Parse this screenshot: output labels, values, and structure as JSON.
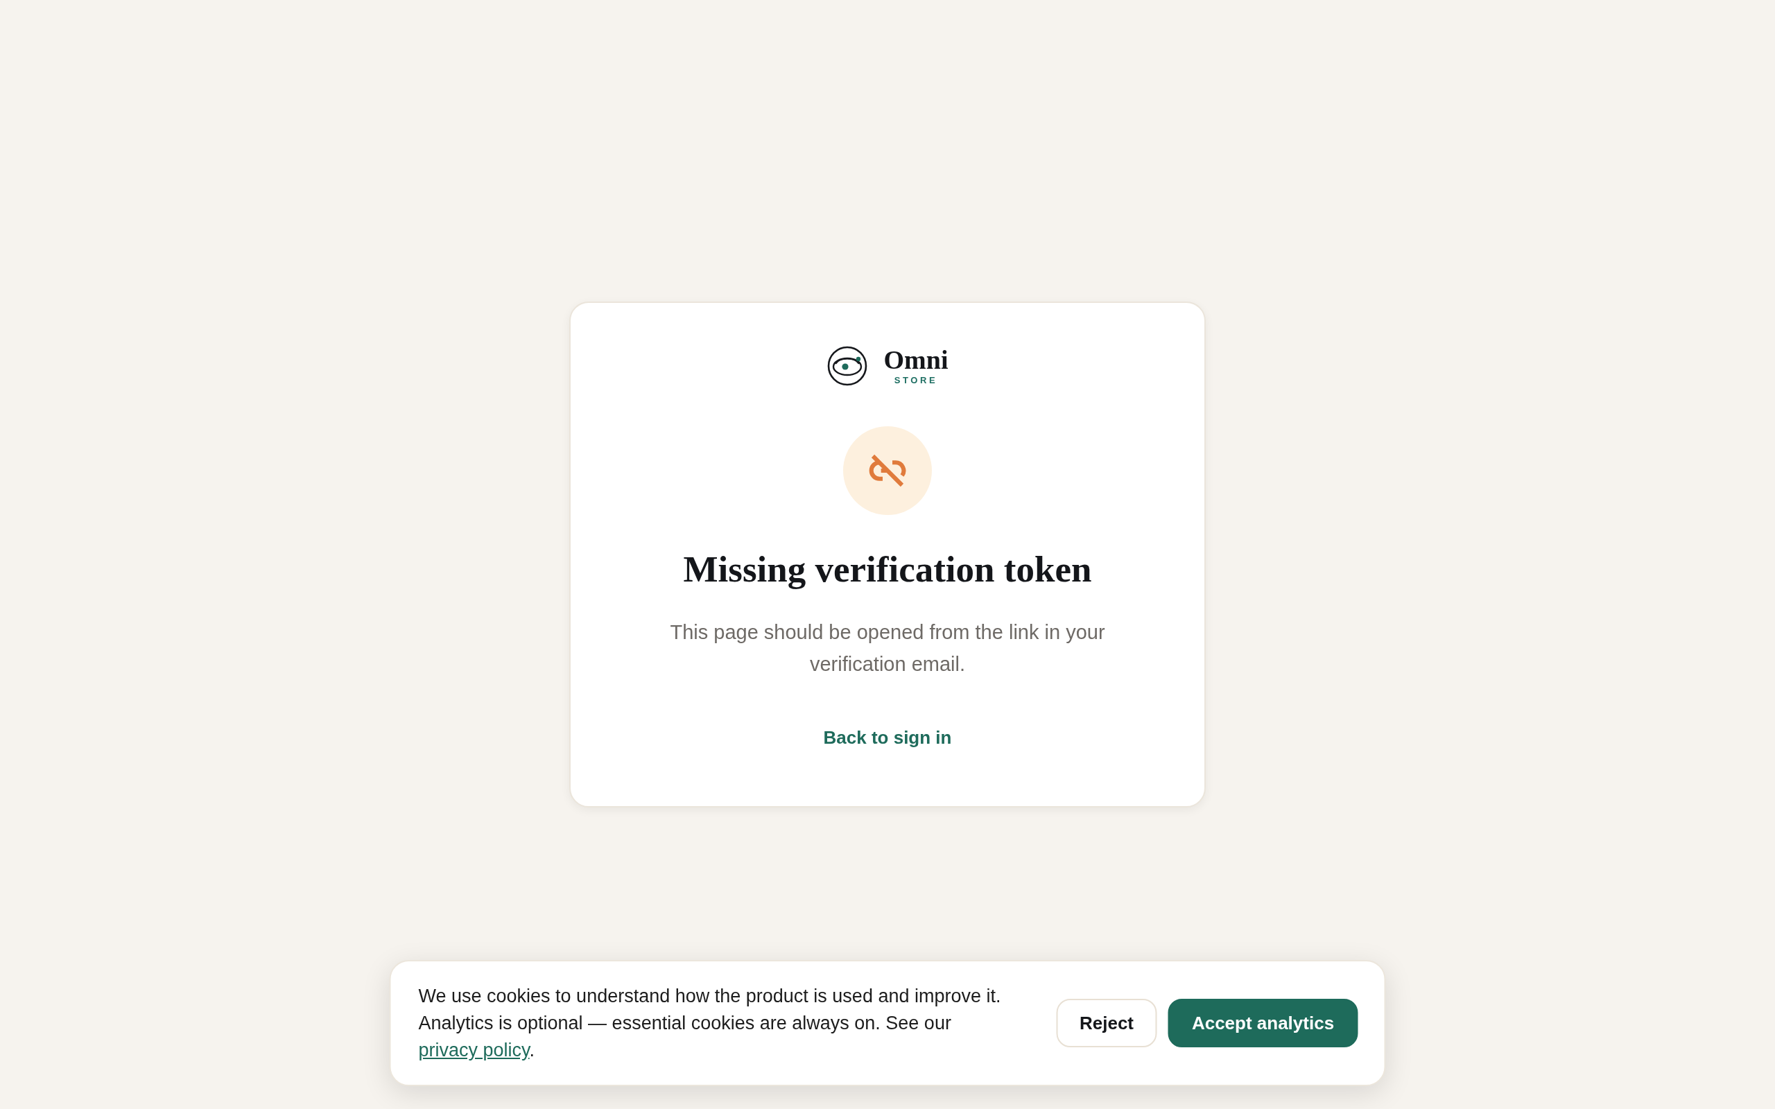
{
  "brand": {
    "name": "Omni",
    "tagline": "STORE"
  },
  "card": {
    "title": "Missing verification token",
    "message": "This page should be opened from the link in your verification email.",
    "link": "Back to sign in"
  },
  "cookie_banner": {
    "text": "We use cookies to understand how the product is used and improve it. Analytics is optional — essential cookies are always on. See our",
    "link": "privacy policy",
    "trailing": ".",
    "buttons": [
      {
        "label": "Reject",
        "kind": "secondary"
      },
      {
        "label": "Accept analytics",
        "kind": "primary"
      }
    ]
  }
}
